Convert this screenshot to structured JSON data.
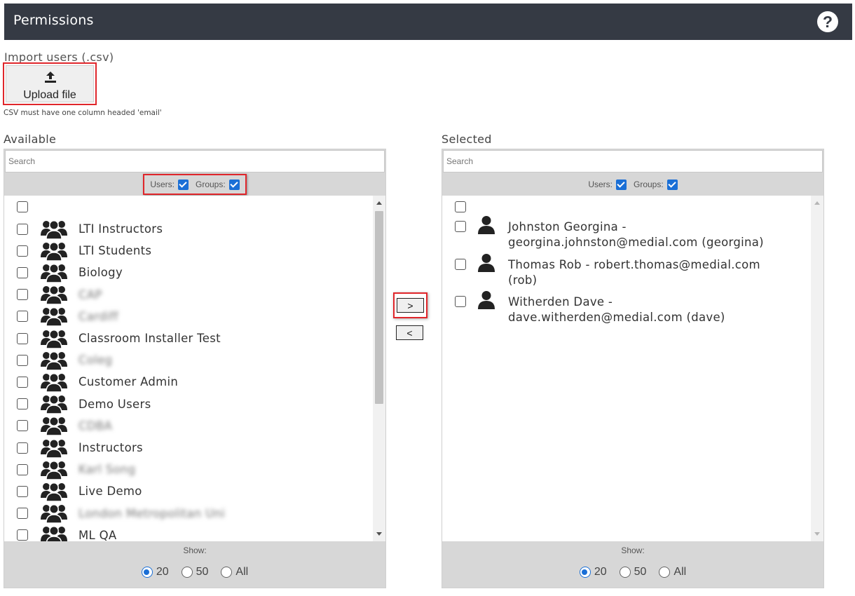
{
  "header": {
    "title": "Permissions"
  },
  "import": {
    "label": "Import users (.csv)",
    "upload_button": "Upload file",
    "note": "CSV must have one column headed 'email'"
  },
  "available": {
    "label": "Available",
    "search_placeholder": "Search",
    "filter_users": "Users:",
    "filter_groups": "Groups:",
    "items": [
      {
        "label": "LTI Instructors",
        "blurred": false
      },
      {
        "label": "LTI Students",
        "blurred": false
      },
      {
        "label": "Biology",
        "blurred": false
      },
      {
        "label": "CAP",
        "blurred": true
      },
      {
        "label": "Cardiff",
        "blurred": true
      },
      {
        "label": "Classroom Installer Test",
        "blurred": false
      },
      {
        "label": "Coleg",
        "blurred": true
      },
      {
        "label": "Customer Admin",
        "blurred": false
      },
      {
        "label": "Demo Users",
        "blurred": false
      },
      {
        "label": "CDBA",
        "blurred": true
      },
      {
        "label": "Instructors",
        "blurred": false
      },
      {
        "label": "Karl Song",
        "blurred": true
      },
      {
        "label": "Live Demo",
        "blurred": false
      },
      {
        "label": "London Metropolitan Uni",
        "blurred": true
      },
      {
        "label": "ML QA",
        "blurred": false
      }
    ],
    "show_label": "Show:",
    "show_options": [
      "20",
      "50",
      "All"
    ],
    "show_selected": "20"
  },
  "selected": {
    "label": "Selected",
    "search_placeholder": "Search",
    "filter_users": "Users:",
    "filter_groups": "Groups:",
    "users": [
      {
        "line1": "Johnston Georgina -",
        "line2": "georgina.johnston@medial.com (georgina)"
      },
      {
        "line1": "Thomas Rob - robert.thomas@medial.com",
        "line2": "(rob)"
      },
      {
        "line1": "Witherden Dave -",
        "line2": "dave.witherden@medial.com (dave)"
      }
    ],
    "show_label": "Show:",
    "show_options": [
      "20",
      "50",
      "All"
    ],
    "show_selected": "20"
  },
  "controls": {
    "move_right": ">",
    "move_left": "<"
  },
  "colors": {
    "header_bg": "#353a44",
    "highlight": "#e0262b",
    "accent": "#1a6fd6"
  }
}
